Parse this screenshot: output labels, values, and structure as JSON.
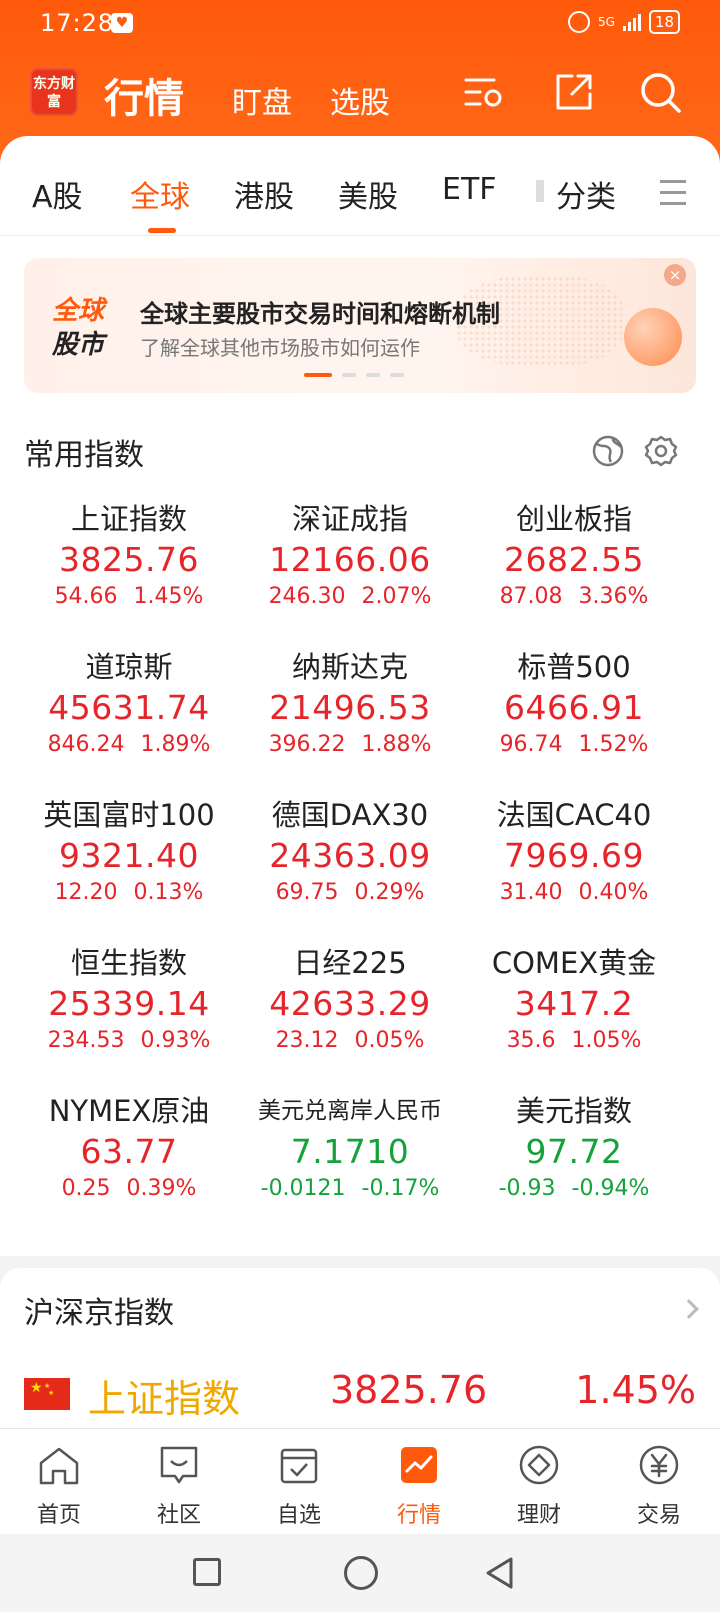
{
  "status_bar": {
    "time": "17:28",
    "network": "5G",
    "battery": "18"
  },
  "header": {
    "logo_text": "东方财富",
    "title": "行情",
    "links": [
      "盯盘",
      "选股"
    ]
  },
  "tabs": [
    "A股",
    "全球",
    "港股",
    "美股",
    "ETF",
    "分类"
  ],
  "active_tab": "全球",
  "banner": {
    "logo_line1": "全球",
    "logo_line2": "股市",
    "title": "全球主要股市交易时间和熔断机制",
    "subtitle": "了解全球其他市场股市如何运作",
    "close": "×"
  },
  "section_common": {
    "title": "常用指数"
  },
  "indices": [
    {
      "name": "上证指数",
      "price": "3825.76",
      "change": "54.66",
      "pct": "1.45%",
      "dir": "up"
    },
    {
      "name": "深证成指",
      "price": "12166.06",
      "change": "246.30",
      "pct": "2.07%",
      "dir": "up"
    },
    {
      "name": "创业板指",
      "price": "2682.55",
      "change": "87.08",
      "pct": "3.36%",
      "dir": "up"
    },
    {
      "name": "道琼斯",
      "price": "45631.74",
      "change": "846.24",
      "pct": "1.89%",
      "dir": "up"
    },
    {
      "name": "纳斯达克",
      "price": "21496.53",
      "change": "396.22",
      "pct": "1.88%",
      "dir": "up"
    },
    {
      "name": "标普500",
      "price": "6466.91",
      "change": "96.74",
      "pct": "1.52%",
      "dir": "up"
    },
    {
      "name": "英国富时100",
      "price": "9321.40",
      "change": "12.20",
      "pct": "0.13%",
      "dir": "up"
    },
    {
      "name": "德国DAX30",
      "price": "24363.09",
      "change": "69.75",
      "pct": "0.29%",
      "dir": "up"
    },
    {
      "name": "法国CAC40",
      "price": "7969.69",
      "change": "31.40",
      "pct": "0.40%",
      "dir": "up"
    },
    {
      "name": "恒生指数",
      "price": "25339.14",
      "change": "234.53",
      "pct": "0.93%",
      "dir": "up"
    },
    {
      "name": "日经225",
      "price": "42633.29",
      "change": "23.12",
      "pct": "0.05%",
      "dir": "up"
    },
    {
      "name": "COMEX黄金",
      "price": "3417.2",
      "change": "35.6",
      "pct": "1.05%",
      "dir": "up"
    },
    {
      "name": "NYMEX原油",
      "price": "63.77",
      "change": "0.25",
      "pct": "0.39%",
      "dir": "up"
    },
    {
      "name": "美元兑离岸人民币",
      "price": "7.1710",
      "change": "-0.0121",
      "pct": "-0.17%",
      "dir": "down"
    },
    {
      "name": "美元指数",
      "price": "97.72",
      "change": "-0.93",
      "pct": "-0.94%",
      "dir": "down"
    }
  ],
  "section_hs": {
    "title": "沪深京指数",
    "row": {
      "name": "上证指数",
      "price": "3825.76",
      "pct": "1.45%"
    }
  },
  "bottom_nav": [
    "首页",
    "社区",
    "自选",
    "行情",
    "理财",
    "交易"
  ],
  "bottom_nav_active": "行情",
  "colors": {
    "brand": "#ff5a0c",
    "up": "#e6252a",
    "down": "#15a23a"
  }
}
